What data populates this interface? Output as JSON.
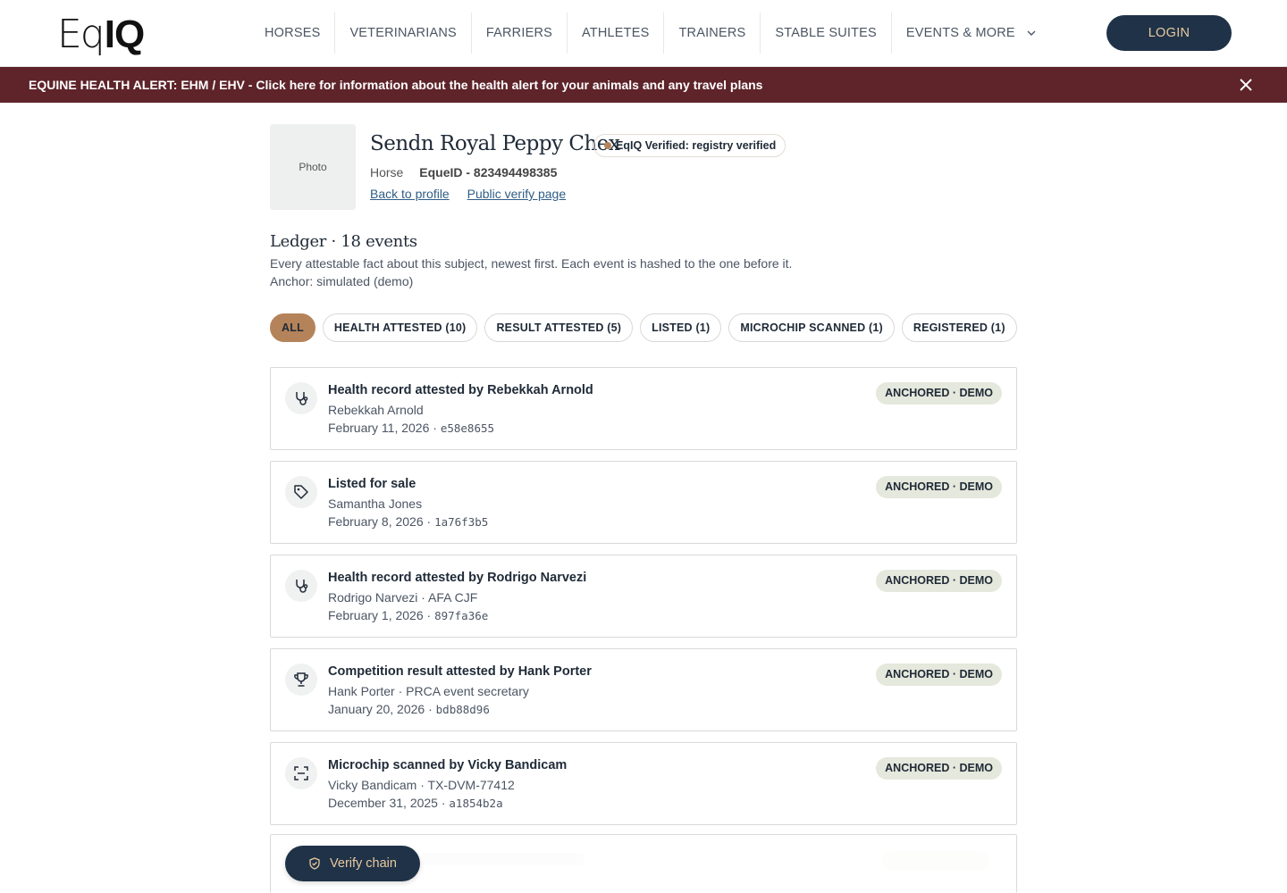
{
  "header": {
    "logo": {
      "part1": "Eq",
      "part2": "IQ"
    },
    "nav": [
      {
        "label": "HORSES"
      },
      {
        "label": "VETERINARIANS"
      },
      {
        "label": "FARRIERS"
      },
      {
        "label": "ATHLETES"
      },
      {
        "label": "TRAINERS"
      },
      {
        "label": "STABLE SUITES"
      },
      {
        "label": "EVENTS & MORE"
      }
    ],
    "login_label": "LOGIN"
  },
  "alert": {
    "text": "EQUINE HEALTH ALERT: EHM / EHV - Click here for information about the health alert for your animals and any travel plans",
    "close_icon": "close-icon"
  },
  "profile": {
    "photo_label": "Photo",
    "name": "Sendn Royal Peppy Chex",
    "verified_label": "EqIQ Verified: registry verified",
    "type": "Horse",
    "equeid": "EqueID - 823494498385",
    "back_link": "Back to profile",
    "public_link": "Public verify page"
  },
  "ledger": {
    "title": "Ledger · 18 events",
    "description": "Every attestable fact about this subject, newest first. Each event is hashed to the one before it.",
    "anchor": "Anchor: simulated (demo)"
  },
  "filters": [
    {
      "label": "ALL",
      "active": true
    },
    {
      "label": "HEALTH ATTESTED (10)",
      "active": false
    },
    {
      "label": "RESULT ATTESTED (5)",
      "active": false
    },
    {
      "label": "LISTED (1)",
      "active": false
    },
    {
      "label": "MICROCHIP SCANNED (1)",
      "active": false
    },
    {
      "label": "REGISTERED (1)",
      "active": false
    }
  ],
  "events": [
    {
      "icon": "stethoscope-icon",
      "title": "Health record attested by Rebekkah Arnold",
      "who": "Rebekkah Arnold",
      "date": "February 11, 2026 · ",
      "hash": "e58e8655",
      "badge": "ANCHORED · DEMO"
    },
    {
      "icon": "tag-icon",
      "title": "Listed for sale",
      "who": "Samantha Jones",
      "date": "February 8, 2026 · ",
      "hash": "1a76f3b5",
      "badge": "ANCHORED · DEMO"
    },
    {
      "icon": "stethoscope-icon",
      "title": "Health record attested by Rodrigo Narvezi",
      "who": "Rodrigo Narvezi · AFA CJF",
      "date": "February 1, 2026 · ",
      "hash": "897fa36e",
      "badge": "ANCHORED · DEMO"
    },
    {
      "icon": "trophy-icon",
      "title": "Competition result attested by Hank Porter",
      "who": "Hank Porter · PRCA event secretary",
      "date": "January 20, 2026 · ",
      "hash": "bdb88d96",
      "badge": "ANCHORED · DEMO"
    },
    {
      "icon": "scan-icon",
      "title": "Microchip scanned by Vicky Bandicam",
      "who": "Vicky Bandicam · TX-DVM-77412",
      "date": "December 31, 2025 · ",
      "hash": "a1854b2a",
      "badge": "ANCHORED · DEMO"
    }
  ],
  "verify_label": "Verify chain"
}
